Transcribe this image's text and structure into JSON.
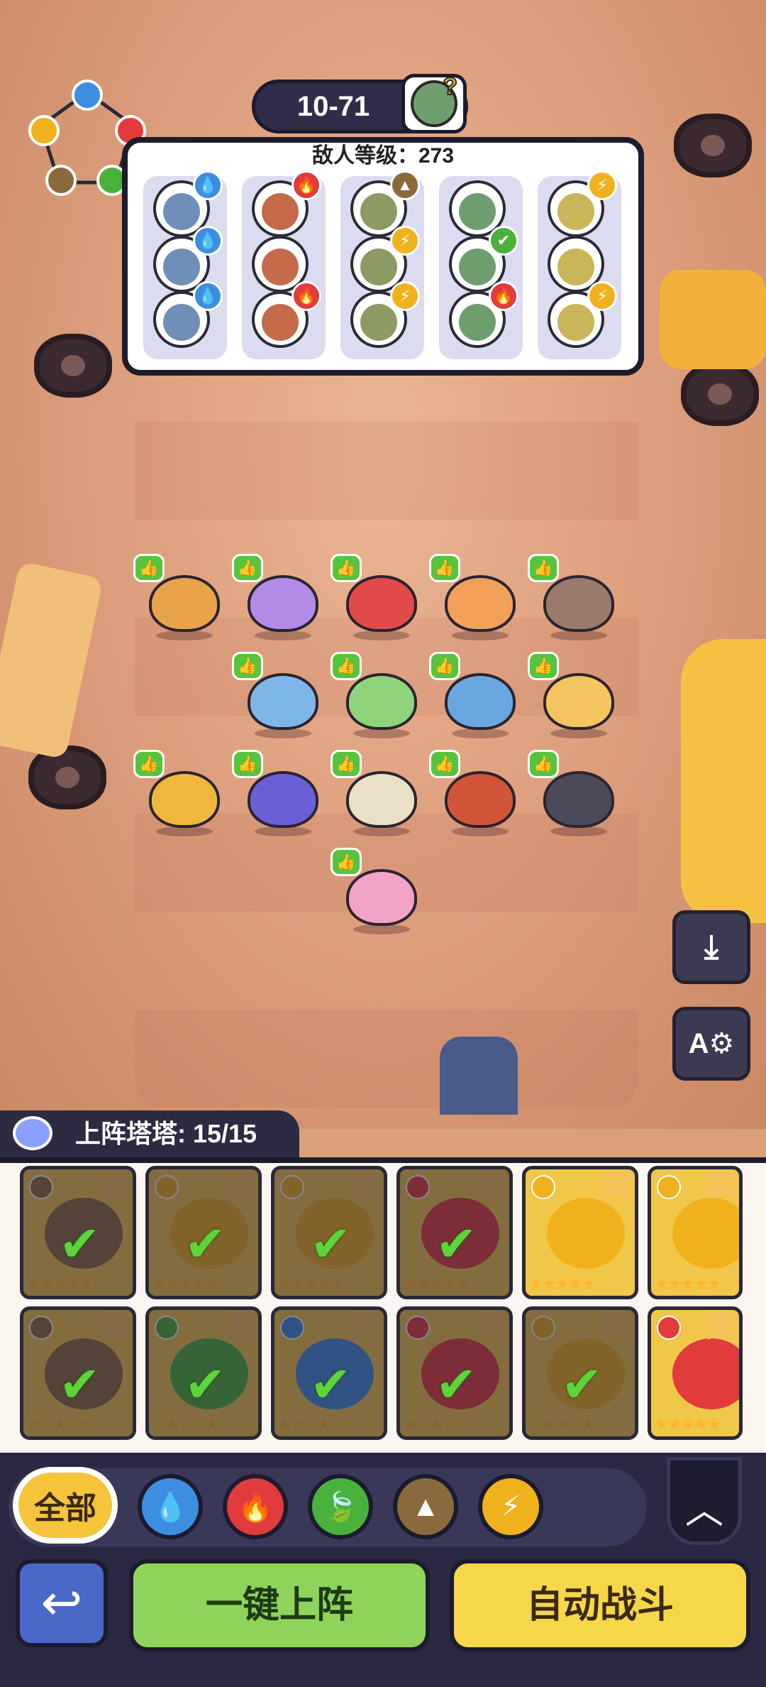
{
  "stage": {
    "label": "10-71"
  },
  "enemy": {
    "level_label": "敌人等级：273"
  },
  "roster": {
    "label": "上阵塔塔: 15/15"
  },
  "filters": {
    "all_label": "全部"
  },
  "actions": {
    "deploy_label": "一键上阵",
    "auto_label": "自动战斗",
    "back_icon": "back-arrow-icon"
  },
  "side_buttons": [
    {
      "name": "download-icon",
      "glyph": "⤓"
    },
    {
      "name": "auto-settings-icon",
      "glyph": "A⚙"
    }
  ],
  "colors": {
    "water": "#3c8fe0",
    "fire": "#e23b3b",
    "grass": "#49b23c",
    "earth": "#8a6a3c",
    "electric": "#f0b21c",
    "deploy": "#8fd45a",
    "auto": "#f6d74a"
  },
  "enemy_columns": [
    {
      "element": "water",
      "monsters": [
        "water",
        "water",
        "water"
      ]
    },
    {
      "element": "fire",
      "monsters": [
        "fire",
        "none",
        "fire"
      ]
    },
    {
      "element": "earth",
      "monsters": [
        "earth",
        "electric",
        "electric"
      ]
    },
    {
      "element": "grass",
      "monsters": [
        "none",
        "grass",
        "fire"
      ]
    },
    {
      "element": "electric",
      "monsters": [
        "electric",
        "none",
        "electric"
      ]
    }
  ],
  "cards_row1": [
    {
      "element": "earth",
      "stars": "★★★★★",
      "selected": true
    },
    {
      "element": "electric",
      "stars": "★★★★★",
      "selected": true
    },
    {
      "element": "electric",
      "stars": "★★★★★",
      "selected": true
    },
    {
      "element": "fire",
      "stars": "★★★★★",
      "selected": true
    },
    {
      "element": "electric",
      "stars": "★★★★★",
      "selected": false
    },
    {
      "element": "electric",
      "stars": "★★★★★",
      "selected": false
    }
  ],
  "cards_row2": [
    {
      "element": "earth",
      "stars": "★★★★★",
      "selected": true
    },
    {
      "element": "grass",
      "stars": "★★★★★",
      "selected": true
    },
    {
      "element": "water",
      "stars": "★★★★★",
      "selected": true
    },
    {
      "element": "fire",
      "stars": "★★★★★",
      "selected": true
    },
    {
      "element": "electric",
      "stars": "★★★★★",
      "selected": true
    },
    {
      "element": "fire",
      "stars": "★★★★★",
      "selected": false
    }
  ]
}
